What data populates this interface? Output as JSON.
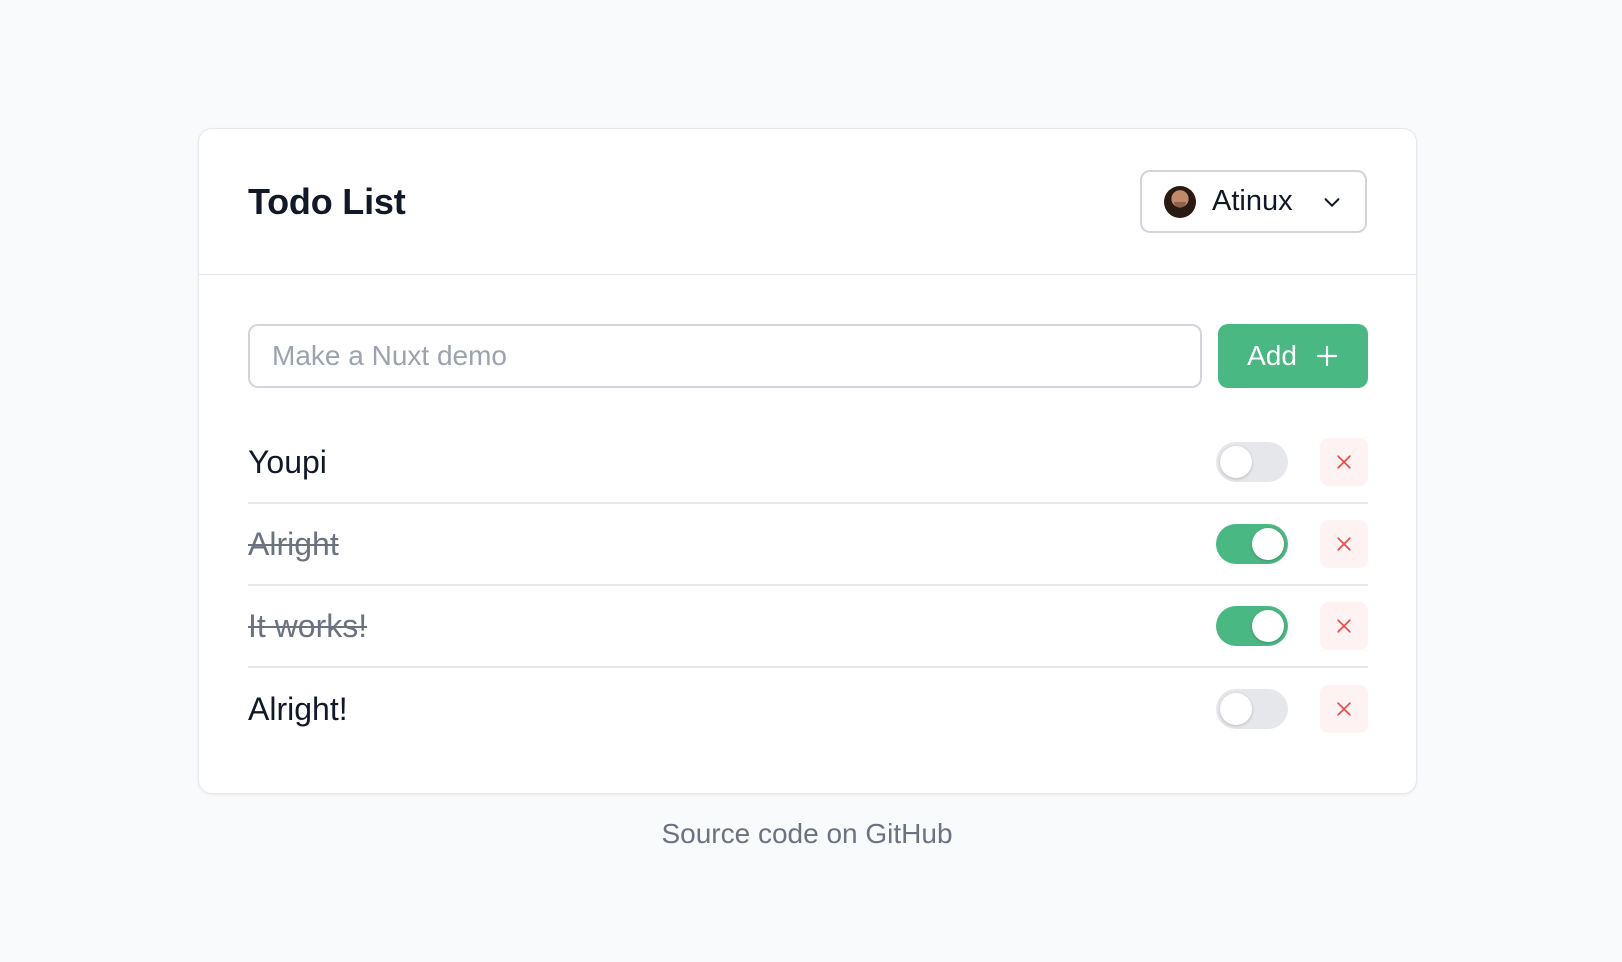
{
  "header": {
    "title": "Todo List",
    "user": {
      "name": "Atinux",
      "avatar_icon": "user-avatar",
      "dropdown_icon": "chevron-down-icon"
    }
  },
  "add_form": {
    "placeholder": "Make a Nuxt demo",
    "value": "",
    "add_label": "Add",
    "add_icon": "plus-icon"
  },
  "todos": [
    {
      "text": "Youpi",
      "completed": false
    },
    {
      "text": "Alright",
      "completed": true
    },
    {
      "text": "It works!",
      "completed": true
    },
    {
      "text": "Alright!",
      "completed": false
    }
  ],
  "footer": {
    "link_text": "Source code on GitHub"
  },
  "colors": {
    "accent": "#4ab883",
    "danger": "#ef4444",
    "danger_bg": "#fef2f2",
    "background": "#f8fafc"
  }
}
